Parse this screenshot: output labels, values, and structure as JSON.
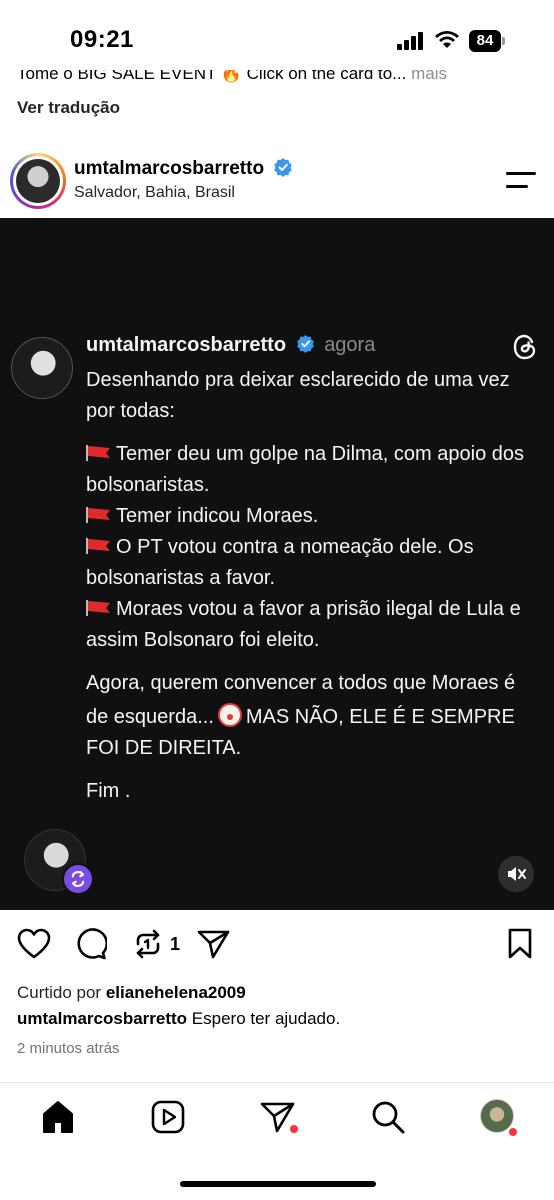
{
  "status_bar": {
    "time": "09:21",
    "battery": "84"
  },
  "previous_post": {
    "caption_partial": "Tome o BIG SALE EVENT 🔥 Click on the card to...",
    "more_label": "mais",
    "translate_label": "Ver tradução"
  },
  "post": {
    "username": "umtalmarcosbarretto",
    "location": "Salvador, Bahia, Brasil",
    "thread": {
      "username": "umtalmarcosbarretto",
      "time": "agora",
      "intro": "Desenhando pra deixar esclarecido de uma vez por todas:",
      "points": [
        "Temer deu um golpe na Dilma, com apoio dos bolsonaristas.",
        "Temer indicou Moraes.",
        "O PT votou contra a nomeação dele. Os bolsonaristas a favor.",
        "Moraes votou a favor a prisão ilegal de Lula e assim Bolsonaro foi eleito."
      ],
      "conclusion_before": "Agora, querem convencer a todos que Moraes é de esquerda...",
      "conclusion_after": "MAS NÃO, ELE É E SEMPRE FOI DE DIREITA.",
      "ending": "Fim ."
    },
    "repost_count": "1",
    "liked_by_label": "Curtido por",
    "liked_by_user": "elianehelena2009",
    "caption_user": "umtalmarcosbarretto",
    "caption_text": "Espero ter ajudado.",
    "time_ago": "2 minutos atrás"
  },
  "icons": {
    "status": [
      "signal-icon",
      "wifi-icon",
      "battery-icon"
    ],
    "header": [
      "verified-icon",
      "menu-icon"
    ],
    "media": [
      "threads-logo-icon",
      "repost-badge-icon",
      "mute-icon"
    ],
    "actions": [
      "heart-icon",
      "comment-icon",
      "repost-icon",
      "share-icon",
      "bookmark-icon"
    ],
    "nav": [
      "home-icon",
      "reels-icon",
      "direct-icon",
      "search-icon",
      "profile-icon"
    ]
  },
  "colors": {
    "accent": "#3897f0",
    "notification": "#ff3040",
    "media_bg": "#101010"
  }
}
